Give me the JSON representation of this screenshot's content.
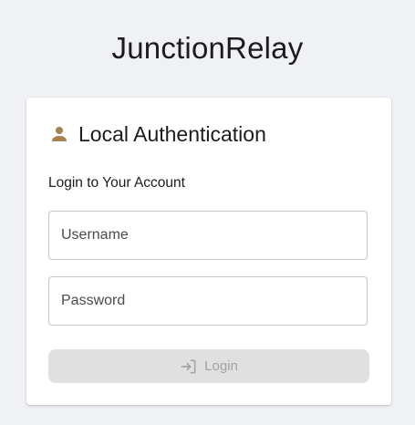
{
  "app": {
    "title": "JunctionRelay"
  },
  "card": {
    "icon": "person-icon",
    "title": "Local Authentication",
    "subtitle": "Login to Your Account"
  },
  "form": {
    "username": {
      "placeholder": "Username",
      "value": ""
    },
    "password": {
      "placeholder": "Password",
      "value": ""
    },
    "login": {
      "label": "Login",
      "icon": "login-icon",
      "disabled": true
    }
  },
  "colors": {
    "background": "#f0f1f5",
    "card": "#ffffff",
    "icon_accent": "#a5834f",
    "button_disabled_bg": "#e0e0e0",
    "button_disabled_text": "#a3a3a6",
    "field_border": "#c6c6c8"
  }
}
